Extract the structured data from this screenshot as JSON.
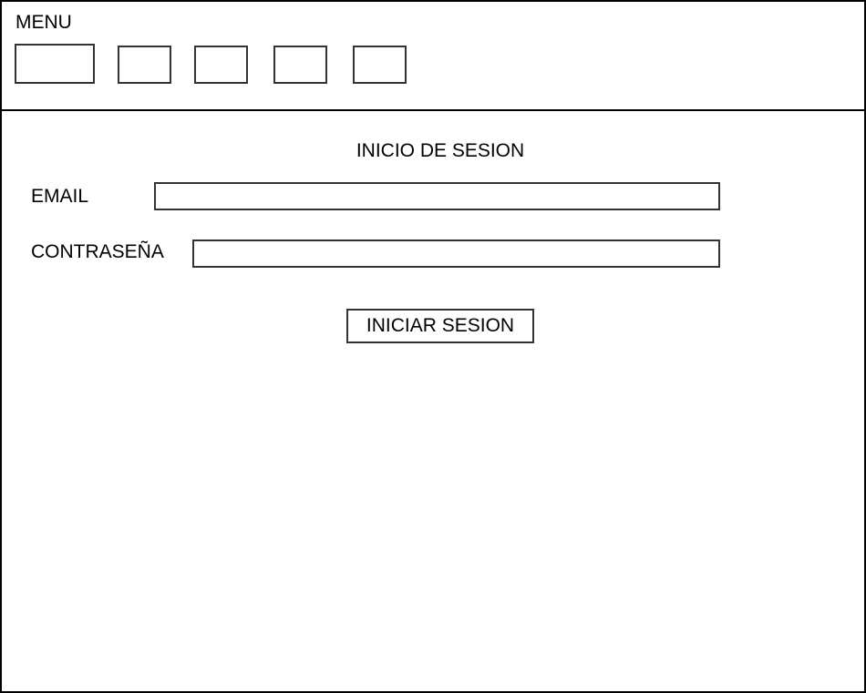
{
  "header": {
    "menu_label": "MENU",
    "menu_items": [
      "",
      "",
      "",
      "",
      ""
    ]
  },
  "login": {
    "title": "INICIO DE SESION",
    "email_label": "EMAIL",
    "email_value": "",
    "password_label": "CONTRASEÑA",
    "password_value": "",
    "submit_label": "INICIAR SESION"
  }
}
